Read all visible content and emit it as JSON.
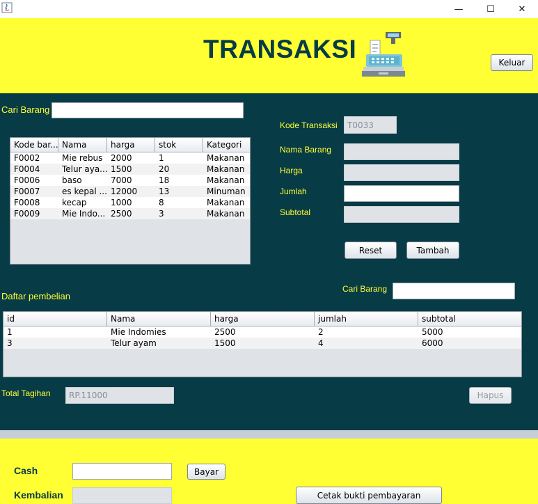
{
  "window": {
    "minimize_glyph": "—",
    "maximize_glyph": "☐",
    "close_glyph": "✕"
  },
  "header": {
    "title": "TRANSAKSI",
    "logout_label": "Keluar",
    "icon": "cash-register-icon"
  },
  "search_top": {
    "label": "Cari Barang",
    "value": ""
  },
  "products_table": {
    "columns": [
      "Kode bar...",
      "Nama",
      "harga",
      "stok",
      "Kategori"
    ],
    "rows": [
      [
        "F0002",
        "Mie rebus",
        "2000",
        "1",
        "Makanan"
      ],
      [
        "F0004",
        "Telur aya...",
        "1500",
        "20",
        "Makanan"
      ],
      [
        "F0006",
        "baso",
        "7000",
        "18",
        "Makanan"
      ],
      [
        "F0007",
        "es kepal ...",
        "12000",
        "13",
        "Minuman"
      ],
      [
        "F0008",
        "kecap",
        "1000",
        "8",
        "Makanan"
      ],
      [
        "F0009",
        "Mie Indo...",
        "2500",
        "3",
        "Makanan"
      ]
    ]
  },
  "form": {
    "kode_label": "Kode Transaksi",
    "kode_value": "T0033",
    "nama_label": "Nama Barang",
    "nama_value": "",
    "harga_label": "Harga",
    "harga_value": "",
    "jumlah_label": "Jumlah",
    "jumlah_value": "",
    "subtotal_label": "Subtotal",
    "subtotal_value": "",
    "reset_label": "Reset",
    "tambah_label": "Tambah"
  },
  "purchases": {
    "title": "Daftar pembelian",
    "search_label": "Cari Barang",
    "search_value": "",
    "columns": [
      "id",
      "Nama",
      "harga",
      "jumlah",
      "subtotal"
    ],
    "rows": [
      [
        "1",
        "Mie Indomies",
        "2500",
        "2",
        "5000"
      ],
      [
        "3",
        "Telur ayam",
        "1500",
        "4",
        "6000"
      ]
    ],
    "total_label": "Total Tagihan",
    "total_value": "RP.11000",
    "hapus_label": "Hapus"
  },
  "payment": {
    "cash_label": "Cash",
    "cash_value": "",
    "bayar_label": "Bayar",
    "kembalian_label": "Kembalian",
    "kembalian_value": "",
    "cetak_label": "Cetak bukti pembayaran"
  },
  "colors": {
    "accent_yellow": "#ffff33",
    "panel_teal": "#073b46"
  }
}
